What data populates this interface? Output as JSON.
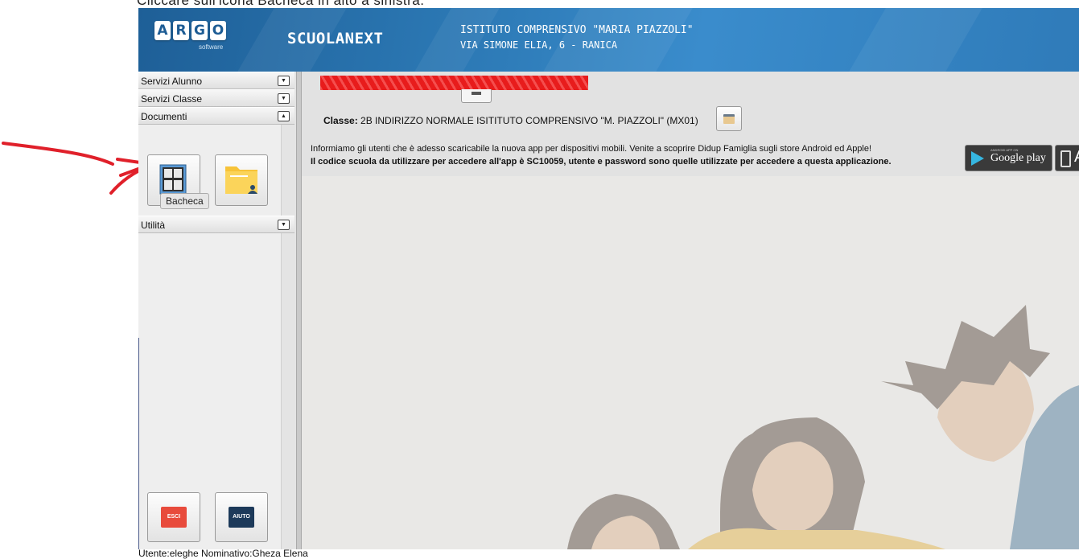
{
  "caption": "Cliccare sull'icona Bacheca in alto a sinistra.",
  "header": {
    "logo_letters": [
      "A",
      "R",
      "G",
      "O"
    ],
    "logo_sub": "software",
    "brand": "SCUOLANEXT",
    "school_name": "ISTITUTO COMPRENSIVO \"MARIA PIAZZOLI\"",
    "school_address": "VIA SIMONE ELIA, 6 - RANICA"
  },
  "sidebar": {
    "sections": [
      {
        "label": "Servizi Alunno",
        "expanded": false
      },
      {
        "label": "Servizi Classe",
        "expanded": false
      },
      {
        "label": "Documenti",
        "expanded": true
      },
      {
        "label": "Utilità",
        "expanded": false
      }
    ],
    "documenti_tooltip": "Bacheca",
    "exit_label": "ESCI",
    "help_label": "AIUTO"
  },
  "main": {
    "classe_label": "Classe:",
    "classe_value": "2B INDIRIZZO NORMALE ISITITUTO COMPRENSIVO \"M. PIAZZOLI\" (MX01)",
    "app_info_line1": "Informiamo gli utenti che è adesso scaricabile la nuova app per dispositivi mobili. Venite a scoprire Didup Famiglia sugli store Android ed Apple!",
    "app_info_line2": "Il codice scuola da utilizzare per accedere all'app è SC10059, utente e password sono quelle utilizzate per accedere a questa applicazione.",
    "google_play_small": "ANDROID APP ON",
    "google_play_label": "Google play",
    "app_store_label": "A"
  },
  "status": {
    "text": "Utente:eleghe Nominativo:Gheza Elena"
  },
  "colors": {
    "header_blue": "#2c79b5",
    "annotation_red": "#e0202a",
    "redaction_red": "#e81c1c",
    "exit_red": "#e84b3c",
    "help_navy": "#1d3a5a"
  }
}
